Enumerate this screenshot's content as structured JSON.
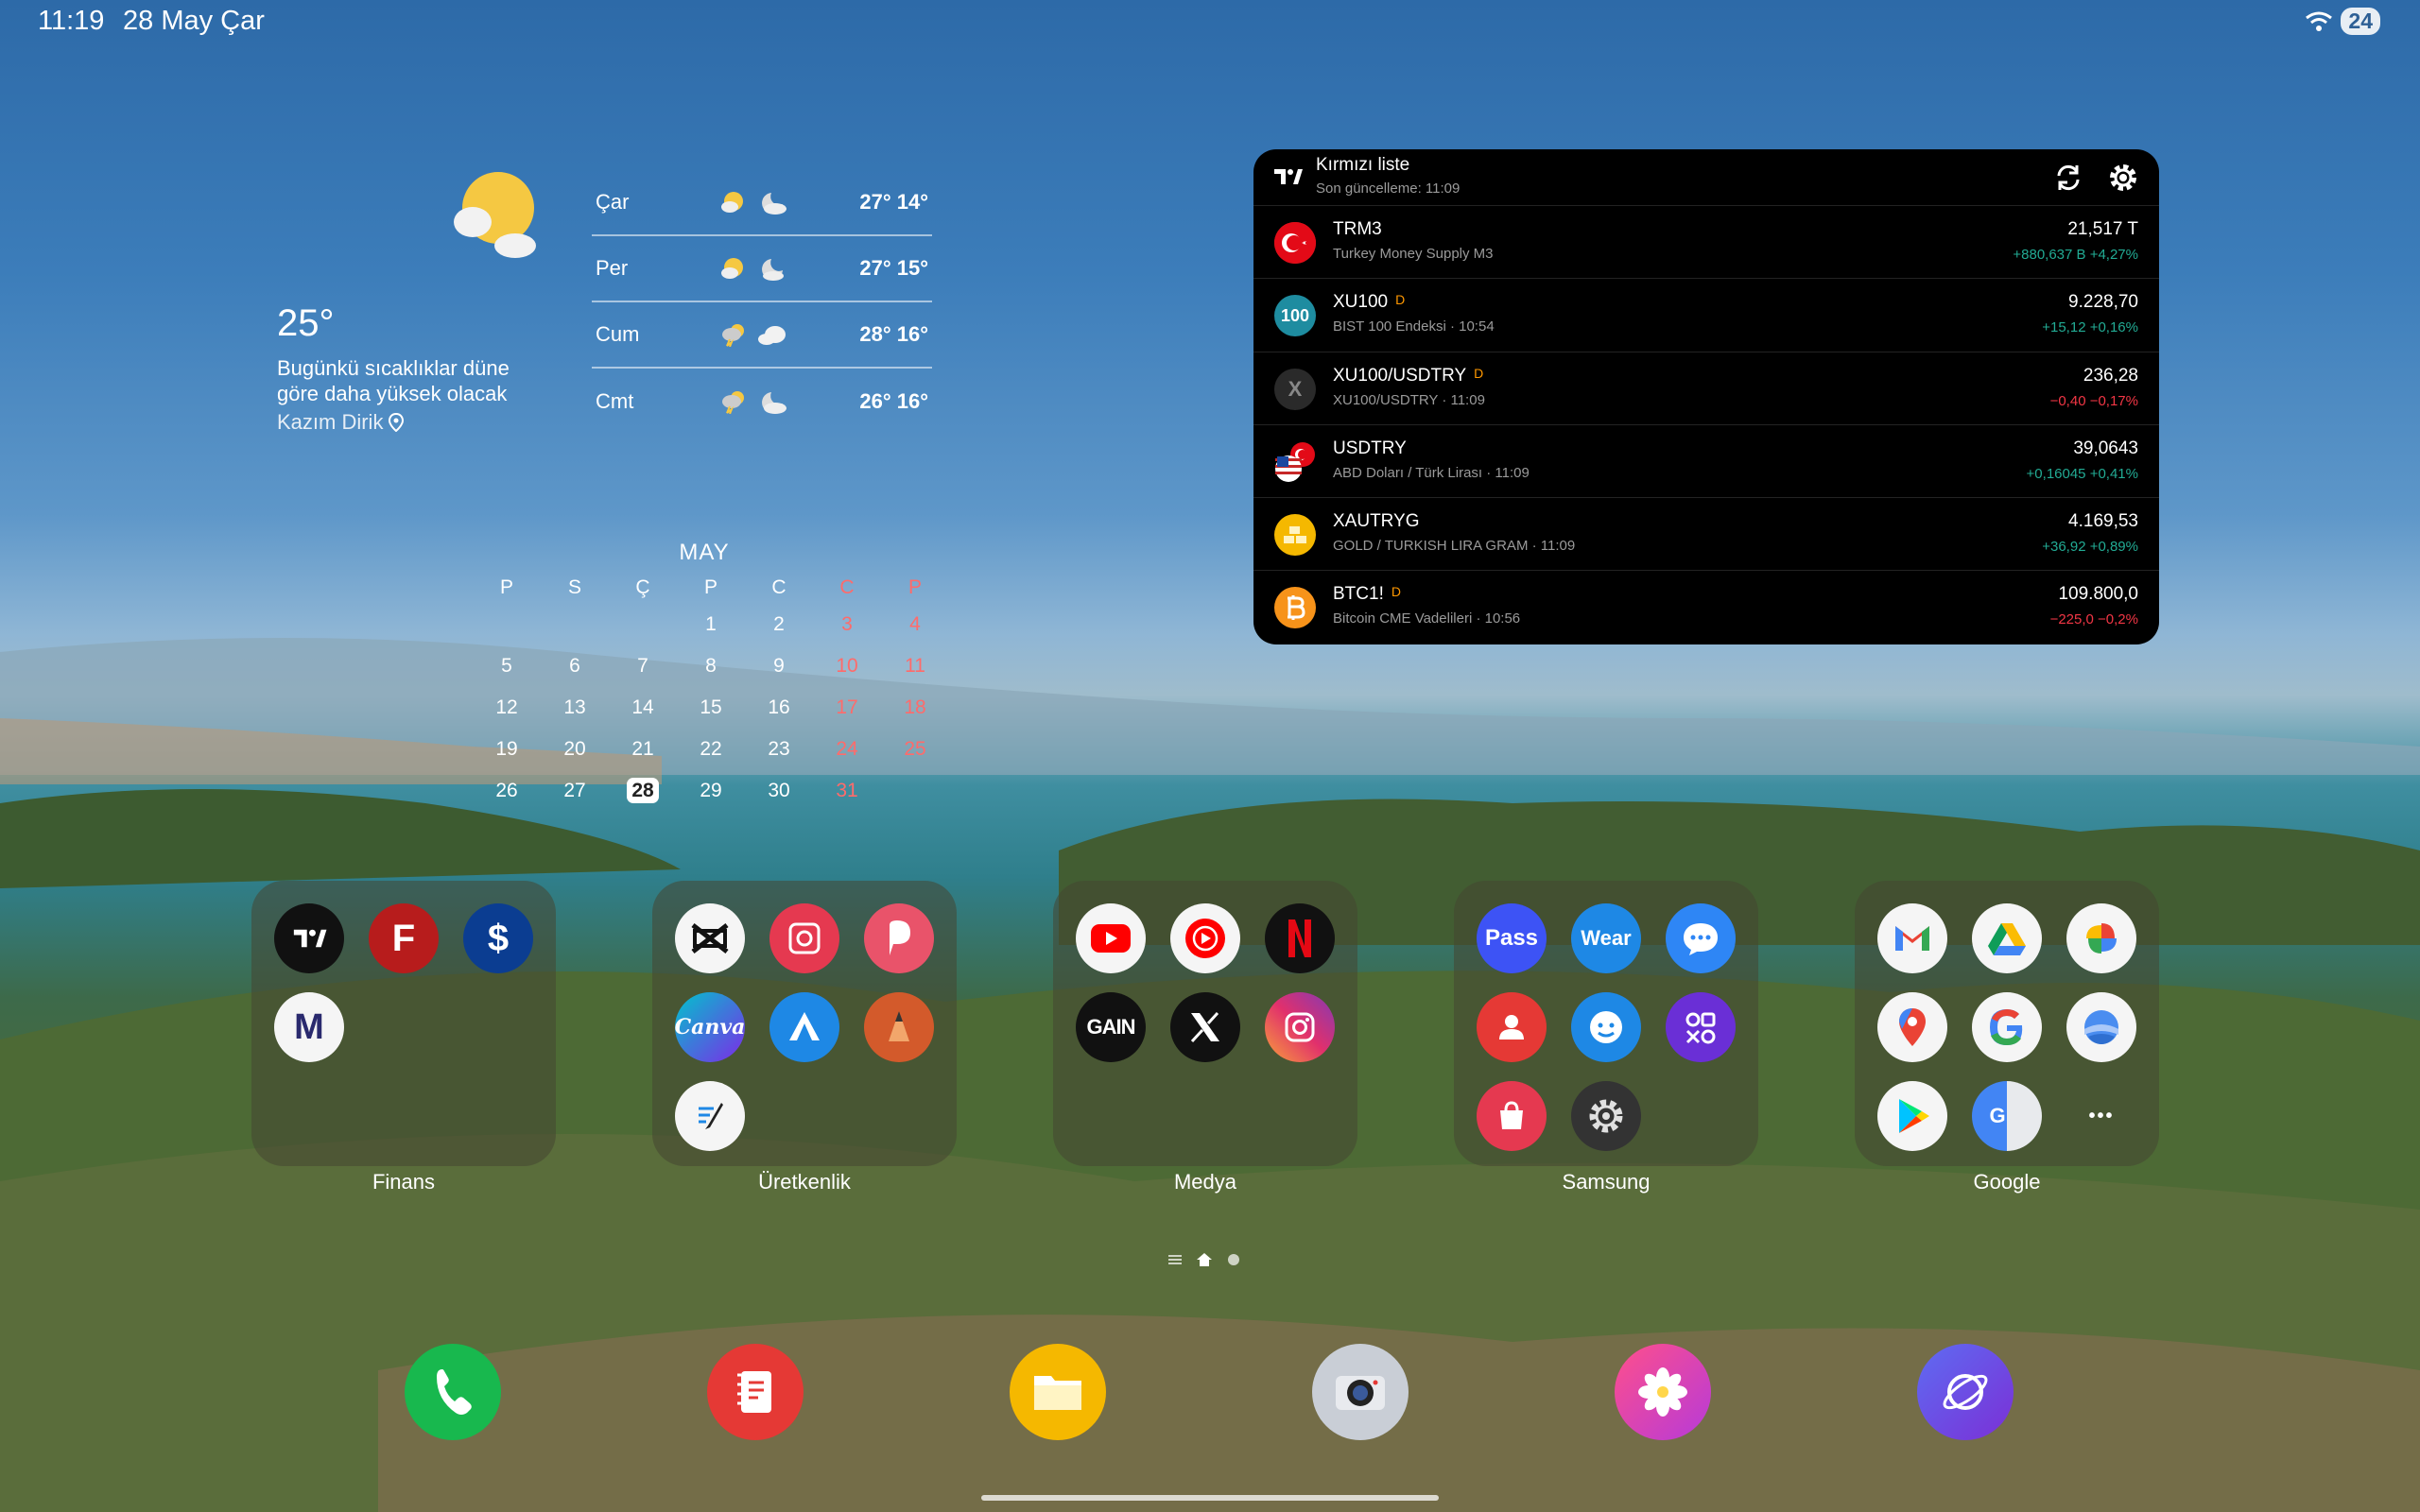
{
  "status_bar": {
    "time": "11:19",
    "date": "28 May Çar",
    "battery": "24"
  },
  "weather": {
    "current_temp": "25°",
    "description": "Bugünkü sıcaklıklar düne göre daha yüksek olacak",
    "location": "Kazım Dirik",
    "forecast": [
      {
        "day": "Çar",
        "temps": "27° 14°"
      },
      {
        "day": "Per",
        "temps": "27° 15°"
      },
      {
        "day": "Cum",
        "temps": "28° 16°"
      },
      {
        "day": "Cmt",
        "temps": "26° 16°"
      }
    ]
  },
  "calendar": {
    "month": "MAY",
    "weekdays": [
      "P",
      "S",
      "Ç",
      "P",
      "C",
      "C",
      "P"
    ],
    "today": "28",
    "rows": [
      [
        "",
        "",
        "",
        "1",
        "2",
        "3",
        "4"
      ],
      [
        "5",
        "6",
        "7",
        "8",
        "9",
        "10",
        "11"
      ],
      [
        "12",
        "13",
        "14",
        "15",
        "16",
        "17",
        "18"
      ],
      [
        "19",
        "20",
        "21",
        "22",
        "23",
        "24",
        "25"
      ],
      [
        "26",
        "27",
        "28",
        "29",
        "30",
        "31",
        ""
      ]
    ]
  },
  "watchlist": {
    "title": "Kırmızı liste",
    "subtitle": "Son güncelleme: 11:09",
    "items": [
      {
        "symbol": "TRM3",
        "flag": "",
        "desc": "Turkey Money Supply M3",
        "value": "21,517 T",
        "change": "+880,637 B +4,27%",
        "dir": "pos"
      },
      {
        "symbol": "XU100",
        "flag": "D",
        "desc": "BIST 100 Endeksi · 10:54",
        "value": "9.228,70",
        "change": "+15,12 +0,16%",
        "dir": "pos"
      },
      {
        "symbol": "XU100/USDTRY",
        "flag": "D",
        "desc": "XU100/USDTRY · 11:09",
        "value": "236,28",
        "change": "−0,40 −0,17%",
        "dir": "neg"
      },
      {
        "symbol": "USDTRY",
        "flag": "",
        "desc": "ABD Doları / Türk Lirası · 11:09",
        "value": "39,0643",
        "change": "+0,16045 +0,41%",
        "dir": "pos"
      },
      {
        "symbol": "XAUTRYG",
        "flag": "",
        "desc": "GOLD / TURKISH LIRA GRAM · 11:09",
        "value": "4.169,53",
        "change": "+36,92 +0,89%",
        "dir": "pos"
      },
      {
        "symbol": "BTC1!",
        "flag": "D",
        "desc": "Bitcoin CME Vadelileri · 10:56",
        "value": "109.800,0",
        "change": "−225,0 −0,2%",
        "dir": "neg"
      }
    ]
  },
  "folders": [
    {
      "label": "Finans"
    },
    {
      "label": "Üretkenlik"
    },
    {
      "label": "Medya"
    },
    {
      "label": "Samsung"
    },
    {
      "label": "Google"
    }
  ],
  "icon_text": {
    "tv": "TV",
    "f": "F",
    "is": "$",
    "matriks": "M",
    "canva": "Canva",
    "gain": "GAIN",
    "x": "X",
    "pass": "Pass",
    "wear": "Wear",
    "g": "G",
    "more": "•••"
  },
  "stock_badges": {
    "xu100": "100",
    "xusd": "X"
  }
}
